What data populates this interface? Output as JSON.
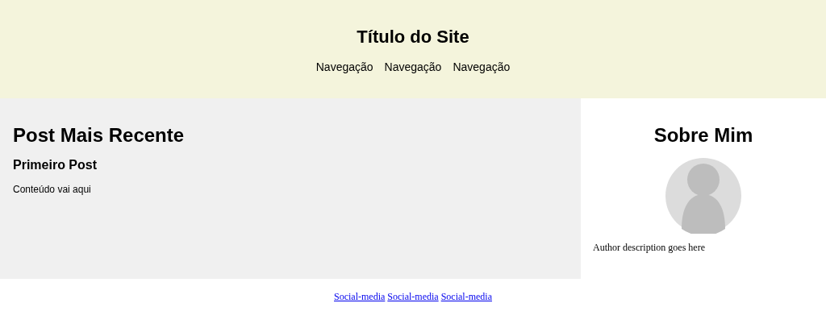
{
  "header": {
    "title": "Título do Site",
    "nav": [
      "Navegação",
      "Navegação",
      "Navegação"
    ]
  },
  "main": {
    "heading": "Post Mais Recente",
    "post": {
      "title": "Primeiro Post",
      "content": "Conteúdo vai aqui"
    }
  },
  "sidebar": {
    "heading": "Sobre Mim",
    "description": "Author description goes here"
  },
  "footer": {
    "links": [
      "Social-media",
      "Social-media",
      "Social-media"
    ]
  }
}
